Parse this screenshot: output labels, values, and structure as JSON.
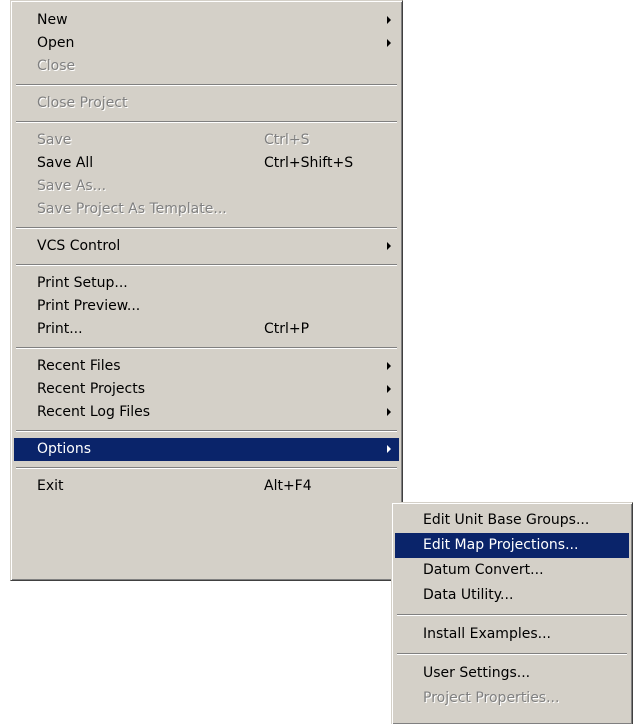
{
  "file_menu": {
    "new": "New",
    "open": "Open",
    "close": "Close",
    "close_project": "Close Project",
    "save": "Save",
    "save_shortcut": "Ctrl+S",
    "save_all": "Save All",
    "save_all_shortcut": "Ctrl+Shift+S",
    "save_as": "Save As...",
    "save_project_as_template": "Save Project As Template...",
    "vcs_control": "VCS Control",
    "print_setup": "Print Setup...",
    "print_preview": "Print Preview...",
    "print": "Print...",
    "print_shortcut": "Ctrl+P",
    "recent_files": "Recent Files",
    "recent_projects": "Recent Projects",
    "recent_log_files": "Recent Log Files",
    "options": "Options",
    "exit": "Exit",
    "exit_shortcut": "Alt+F4"
  },
  "options_submenu": {
    "edit_unit_base_groups": "Edit Unit Base Groups...",
    "edit_map_projections": "Edit Map Projections...",
    "datum_convert": "Datum Convert...",
    "data_utility": "Data Utility...",
    "install_examples": "Install Examples...",
    "user_settings": "User Settings...",
    "project_properties": "Project Properties..."
  },
  "colors": {
    "menu_background": "#d4d0c8",
    "highlight": "#0a246a",
    "disabled_text": "#808080"
  }
}
